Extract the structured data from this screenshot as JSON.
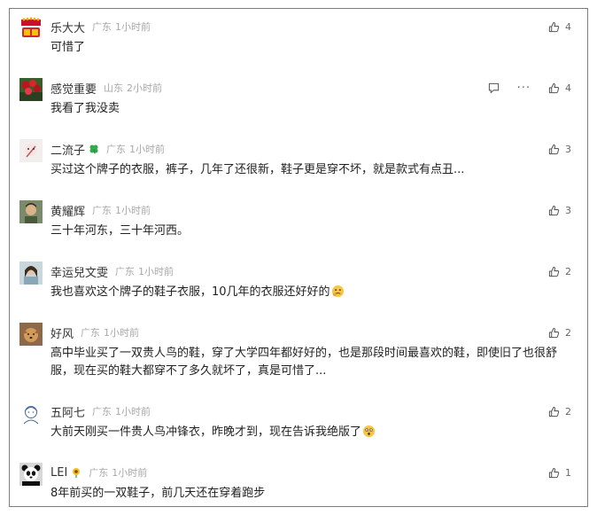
{
  "comments": [
    {
      "name": "乐大大",
      "location": "广东",
      "time": "1小时前",
      "text": "可惜了",
      "likes": "4",
      "avatar": "new-year-badge-avatar",
      "badge": null,
      "emoji": null
    },
    {
      "name": "感觉重要",
      "location": "山东",
      "time": "2小时前",
      "text": "我看了我没卖",
      "likes": "4",
      "avatar": "red-flowers-avatar",
      "badge": null,
      "emoji": null
    },
    {
      "name": "二流子",
      "location": "广东",
      "time": "1小时前",
      "text": "买过这个牌子的衣服，裤子，几年了还很新，鞋子更是穿不坏，就是款式有点丑...",
      "likes": "3",
      "avatar": "cartoon-avatar",
      "badge": "clover-icon",
      "emoji": null
    },
    {
      "name": "黄耀辉",
      "location": "广东",
      "time": "1小时前",
      "text": "三十年河东，三十年河西。",
      "likes": "3",
      "avatar": "portrait-avatar",
      "badge": null,
      "emoji": null
    },
    {
      "name": "幸运兒文雯",
      "location": "广东",
      "time": "1小时前",
      "text": "我也喜欢这个牌子的鞋子衣服，10几年的衣服还好好的",
      "likes": "2",
      "avatar": "girl-photo-avatar",
      "badge": null,
      "emoji": "thinking-emoji"
    },
    {
      "name": "好风",
      "location": "广东",
      "time": "1小时前",
      "text": "高中毕业买了一双贵人鸟的鞋，穿了大学四年都好好的，也是那段时间最喜欢的鞋，即使旧了也很舒服，现在买的鞋大都穿不了多久就坏了，真是可惜了...",
      "likes": "2",
      "avatar": "dog-avatar",
      "badge": null,
      "emoji": null
    },
    {
      "name": "五阿七",
      "location": "广东",
      "time": "1小时前",
      "text": "大前天刚买一件贵人鸟冲锋衣，昨晚才到，现在告诉我绝版了",
      "likes": "2",
      "avatar": "sketch-girl-avatar",
      "badge": null,
      "emoji": "surprised-emoji"
    },
    {
      "name": "LEI",
      "location": "广东",
      "time": "1小时前",
      "text": "8年前买的一双鞋子，前几天还在穿着跑步",
      "likes": "1",
      "avatar": "panda-avatar",
      "badge": "sunflower-icon",
      "emoji": null
    }
  ],
  "colors": {
    "border": "#7d7d7d",
    "meta": "#a8a8a8",
    "text": "#222222"
  }
}
